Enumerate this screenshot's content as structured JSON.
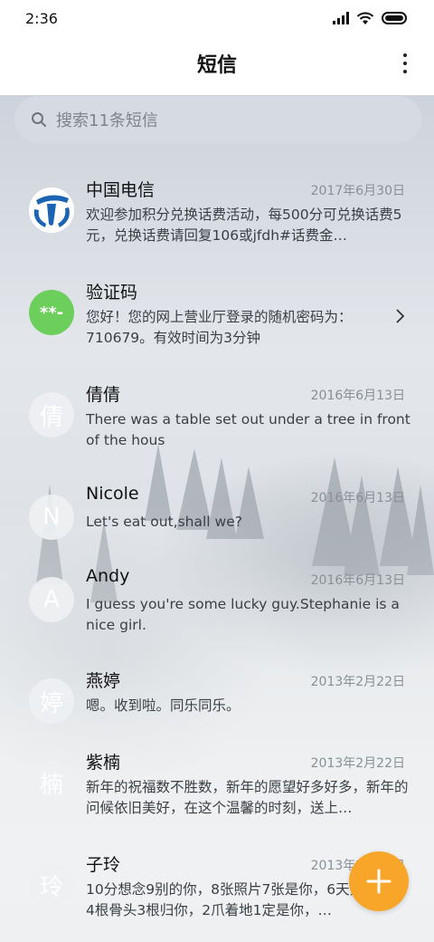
{
  "status_bar": {
    "time": "2:36"
  },
  "app_bar": {
    "title": "短信"
  },
  "search": {
    "placeholder": "搜索11条短信"
  },
  "colors": {
    "accent": "#f8a629",
    "verify_avatar": "#6ccf5b",
    "telecom_blue": "#1b64b3"
  },
  "threads": [
    {
      "name": "中国电信",
      "date": "2017年6月30日",
      "preview": "欢迎参加积分兑换话费活动，每500分可兑换话费5元，兑换话费请回复106或jfdh#话费金…",
      "avatar": "china-telecom-logo"
    },
    {
      "name": "验证码",
      "date": "",
      "preview": "您好！您的网上营业厅登录的随机密码为：710679。有效时间为3分钟",
      "avatar": "**-"
    },
    {
      "name": "倩倩",
      "date": "2016年6月13日",
      "preview": "There was a table set out under a tree in front of the hous",
      "avatar": "倩"
    },
    {
      "name": "Nicole",
      "date": "2016年6月13日",
      "preview": "Let's eat out,shall we?",
      "avatar": "N"
    },
    {
      "name": "Andy",
      "date": "2016年6月13日",
      "preview": "I guess you're some lucky guy.Stephanie is a nice girl.",
      "avatar": "A"
    },
    {
      "name": "燕婷",
      "date": "2013年2月22日",
      "preview": "嗯。收到啦。同乐同乐。",
      "avatar": "婷"
    },
    {
      "name": "紫楠",
      "date": "2013年2月22日",
      "preview": "新年的祝福数不胜数，新年的愿望好多好多，新年的问候依旧美好，在这个温馨的时刻，送上…",
      "avatar": "楠"
    },
    {
      "name": "子玲",
      "date": "2013年2月22日",
      "preview": "10分想念9别的你，8张照片7张是你，6天只像你，4根骨头3根归你，2爪着地1定是你，…",
      "avatar": "玲"
    }
  ]
}
